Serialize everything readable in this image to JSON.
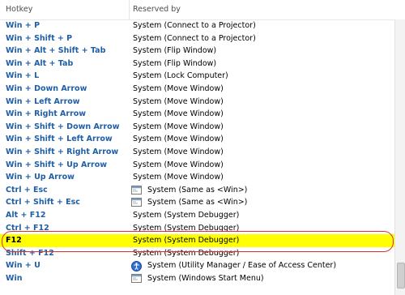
{
  "header": {
    "hotkey": "Hotkey",
    "reserved": "Reserved by"
  },
  "rows": [
    {
      "hotkey": "Win + P",
      "reserved": "System (Connect to a Projector)"
    },
    {
      "hotkey": "Win + Shift + P",
      "reserved": "System (Connect to a Projector)"
    },
    {
      "hotkey": "Win + Alt + Shift + Tab",
      "reserved": "System (Flip Window)"
    },
    {
      "hotkey": "Win + Alt + Tab",
      "reserved": "System (Flip Window)"
    },
    {
      "hotkey": "Win + L",
      "reserved": "System (Lock Computer)"
    },
    {
      "hotkey": "Win + Down Arrow",
      "reserved": "System (Move Window)"
    },
    {
      "hotkey": "Win + Left Arrow",
      "reserved": "System (Move Window)"
    },
    {
      "hotkey": "Win + Right Arrow",
      "reserved": "System (Move Window)"
    },
    {
      "hotkey": "Win + Shift + Down Arrow",
      "reserved": "System (Move Window)"
    },
    {
      "hotkey": "Win + Shift + Left Arrow",
      "reserved": "System (Move Window)"
    },
    {
      "hotkey": "Win + Shift + Right Arrow",
      "reserved": "System (Move Window)"
    },
    {
      "hotkey": "Win + Shift + Up Arrow",
      "reserved": "System (Move Window)"
    },
    {
      "hotkey": "Win + Up Arrow",
      "reserved": "System (Move Window)"
    },
    {
      "hotkey": "Ctrl + Esc",
      "reserved": "System (Same as <Win>)",
      "icon": "window-icon"
    },
    {
      "hotkey": "Ctrl + Shift + Esc",
      "reserved": "System (Same as <Win>)",
      "icon": "window-icon"
    },
    {
      "hotkey": "Alt + F12",
      "reserved": "System (System Debugger)"
    },
    {
      "hotkey": "Ctrl + F12",
      "reserved": "System (System Debugger)"
    },
    {
      "hotkey": "F12",
      "reserved": "System (System Debugger)",
      "selected": true
    },
    {
      "hotkey": "Shift + F12",
      "reserved": "System (System Debugger)"
    },
    {
      "hotkey": "Win + U",
      "reserved": "System (Utility Manager / Ease of Access Center)",
      "icon": "ease-of-access-icon"
    },
    {
      "hotkey": "Win",
      "reserved": "System (Windows Start Menu)",
      "icon": "window-icon"
    }
  ],
  "colors": {
    "hotkey_text": "#1f5fa8",
    "highlight": "#ffff00",
    "annotation_circle": "#e0302a"
  }
}
